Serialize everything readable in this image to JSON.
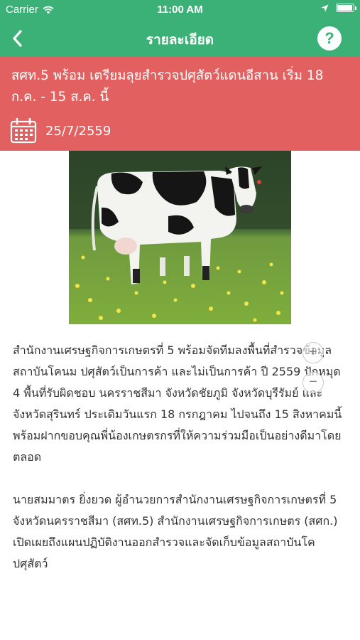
{
  "status_bar": {
    "carrier": "Carrier",
    "time": "11:00 AM",
    "wifi_icon": "wifi-icon",
    "location_icon": "location-arrow-icon",
    "battery_icon": "battery-icon",
    "battery_level": 1.0
  },
  "nav": {
    "title": "รายละเอียด",
    "back_icon": "chevron-left-icon",
    "help_label": "?"
  },
  "article": {
    "headline": "สศท.5 พร้อม เตรียมลุยสำรวจปศุสัตว์แดนอีสาน เริ่ม 18 ก.ค. - 15 ส.ค. นี้",
    "date": "25/7/2559",
    "date_icon": "calendar-icon",
    "image_subject": "cow-photo",
    "paragraphs": [
      "สำนักงานเศรษฐกิจการเกษตรที่ 5 พร้อมจัดทีมลงพื้นที่สำรวจข้อมูล สถาบันโคนม ปศุสัตว์เป็นการค้า และไม่เป็นการค้า ปี 2559 ปักหมุด 4 พื้นที่รับผิดชอบ นครราชสีมา จังหวัดชัยภูมิ จังหวัดบุรีรัมย์ และจังหวัดสุรินทร์ ประเดิมวันแรก 18 กรกฎาคม ไปจนถึง 15 สิงหาคมนี้ พร้อมฝากขอบคุณพี่น้องเกษตรกรที่ให้ความร่วมมือเป็นอย่างดีมาโดยตลอด",
      "นายสมมาตร ยิ่งยวด ผู้อำนวยการสำนักงานเศรษฐกิจการเกษตรที่ 5 จังหวัดนครราชสีมา (สศท.5) สำนักงานเศรษฐกิจการเกษตร (สศก.) เปิดเผยถึงแผนปฏิบัติงานออกสำรวจและจัดเก็บข้อมูลสถาบันโค ปศุสัตว์"
    ]
  },
  "zoom": {
    "in_label": "+",
    "out_label": "−"
  },
  "colors": {
    "nav_green": "#3bb178",
    "headline_red": "#e36060"
  }
}
